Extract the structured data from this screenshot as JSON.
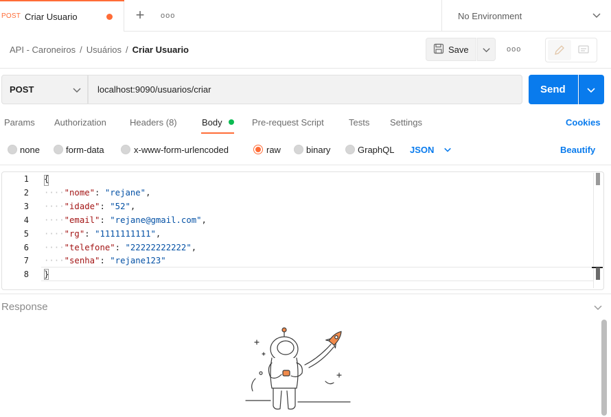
{
  "tab": {
    "method": "POST",
    "title": "Criar Usuario",
    "unsaved": true
  },
  "environment": {
    "label": "No Environment"
  },
  "breadcrumb": {
    "collection": "API - Caroneiros",
    "folder": "Usuários",
    "request": "Criar Usuario",
    "separator": "/"
  },
  "toolbar": {
    "save_label": "Save"
  },
  "request": {
    "method": "POST",
    "url": "localhost:9090/usuarios/criar",
    "send_label": "Send"
  },
  "request_tabs": {
    "params": "Params",
    "authorization": "Authorization",
    "headers": "Headers (8)",
    "body": "Body",
    "prerequest": "Pre-request Script",
    "tests": "Tests",
    "settings": "Settings",
    "cookies": "Cookies"
  },
  "body_types": {
    "none": "none",
    "form_data": "form-data",
    "urlencoded": "x-www-form-urlencoded",
    "raw": "raw",
    "binary": "binary",
    "graphql": "GraphQL",
    "selected": "raw",
    "format": "JSON",
    "beautify": "Beautify"
  },
  "editor": {
    "line_numbers": [
      "1",
      "2",
      "3",
      "4",
      "5",
      "6",
      "7",
      "8"
    ],
    "lines": [
      {
        "dots": "",
        "key": "",
        "sep": "",
        "value": "",
        "raw": "{"
      },
      {
        "dots": "····",
        "key": "\"nome\"",
        "sep": ": ",
        "value": "\"rejane\"",
        "raw": ","
      },
      {
        "dots": "····",
        "key": "\"idade\"",
        "sep": ": ",
        "value": "\"52\"",
        "raw": ","
      },
      {
        "dots": "····",
        "key": "\"email\"",
        "sep": ": ",
        "value": "\"rejane@gmail.com\"",
        "raw": ","
      },
      {
        "dots": "····",
        "key": "\"rg\"",
        "sep": ": ",
        "value": "\"1111111111\"",
        "raw": ","
      },
      {
        "dots": "····",
        "key": "\"telefone\"",
        "sep": ": ",
        "value": "\"22222222222\"",
        "raw": ","
      },
      {
        "dots": "····",
        "key": "\"senha\"",
        "sep": ": ",
        "value": "\"rejane123\"",
        "raw": ""
      },
      {
        "dots": "",
        "key": "",
        "sep": "",
        "value": "",
        "raw": "}"
      }
    ]
  },
  "response": {
    "label": "Response"
  },
  "colors": {
    "accent": "#ff6c37",
    "primary": "#097bed",
    "status_dot": "#0cbb52"
  }
}
